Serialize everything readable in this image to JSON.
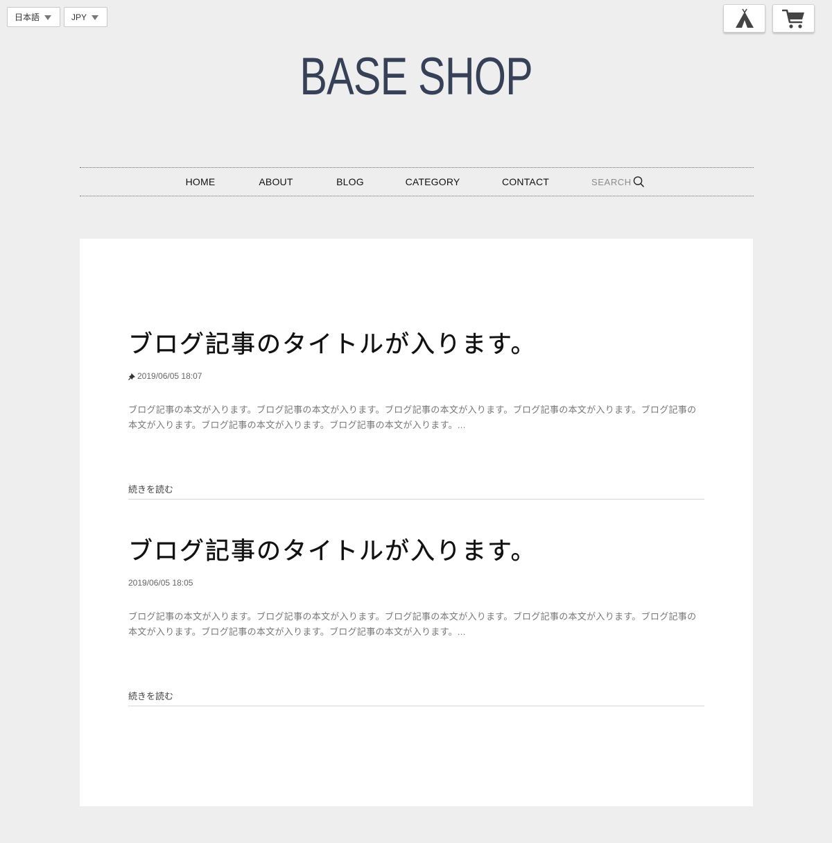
{
  "header": {
    "language_select": "日本語",
    "currency_select": "JPY",
    "shop_title": "BASE SHOP",
    "icons": {
      "base_app": "teepee-icon",
      "cart": "cart-icon"
    }
  },
  "nav": {
    "items": [
      {
        "label": "HOME"
      },
      {
        "label": "ABOUT"
      },
      {
        "label": "BLOG"
      },
      {
        "label": "CATEGORY"
      },
      {
        "label": "CONTACT"
      }
    ],
    "search_label": "SEARCH",
    "search_icon": "search-icon"
  },
  "articles": [
    {
      "title": "ブログ記事のタイトルが入ります。",
      "pinned": true,
      "date": "2019/06/05 18:07",
      "excerpt": "ブログ記事の本文が入ります。ブログ記事の本文が入ります。ブログ記事の本文が入ります。ブログ記事の本文が入ります。ブログ記事の本文が入ります。ブログ記事の本文が入ります。ブログ記事の本文が入ります。...",
      "read_more": "続きを読む"
    },
    {
      "title": "ブログ記事のタイトルが入ります。",
      "pinned": false,
      "date": "2019/06/05 18:05",
      "excerpt": "ブログ記事の本文が入ります。ブログ記事の本文が入ります。ブログ記事の本文が入ります。ブログ記事の本文が入ります。ブログ記事の本文が入ります。ブログ記事の本文が入ります。ブログ記事の本文が入ります。...",
      "read_more": "続きを読む"
    }
  ],
  "colors": {
    "background": "#eeeeee",
    "logo": "#364057",
    "content_background": "#ffffff"
  }
}
